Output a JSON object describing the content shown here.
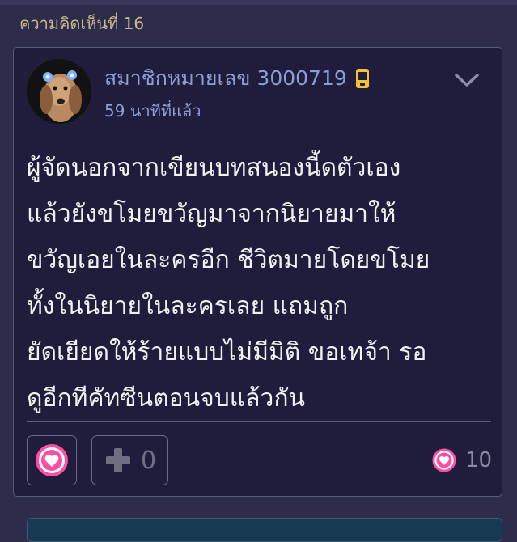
{
  "comment": {
    "number_label": "ความคิดเห็นที่ 16",
    "author": {
      "name": "สมาชิกหมายเลข 3000719",
      "badge_icon": "mobile-phone-icon"
    },
    "time_ago": "59 นาทีที่แล้ว",
    "body_lines": [
      "ผู้จัดนอกจากเขียนบทสนองนี้ดตัวเอง",
      "แล้วยังขโมยขวัญมาจากนิยายมาให้",
      "ขวัญเอยในละครอีก ชีวิตมายโดยขโมย",
      "ทั้งในนิยายในละครเลย แถมถูก",
      "ยัดเยียดให้ร้ายแบบไม่มีมิติ ขอเทจ้า รอ",
      "ดูอีกทีคัทซีนตอนจบแล้วกัน"
    ],
    "actions": {
      "love_icon": "heart-icon",
      "plus_icon": "plus-icon",
      "plus_count": "0",
      "love_count": "10"
    }
  },
  "colors": {
    "background": "#2e2c4b",
    "card": "#1f1d3b",
    "accent_link": "#8c9ed7",
    "comment_number": "#c9b98c",
    "heart_pink": "#ff4fa3"
  }
}
